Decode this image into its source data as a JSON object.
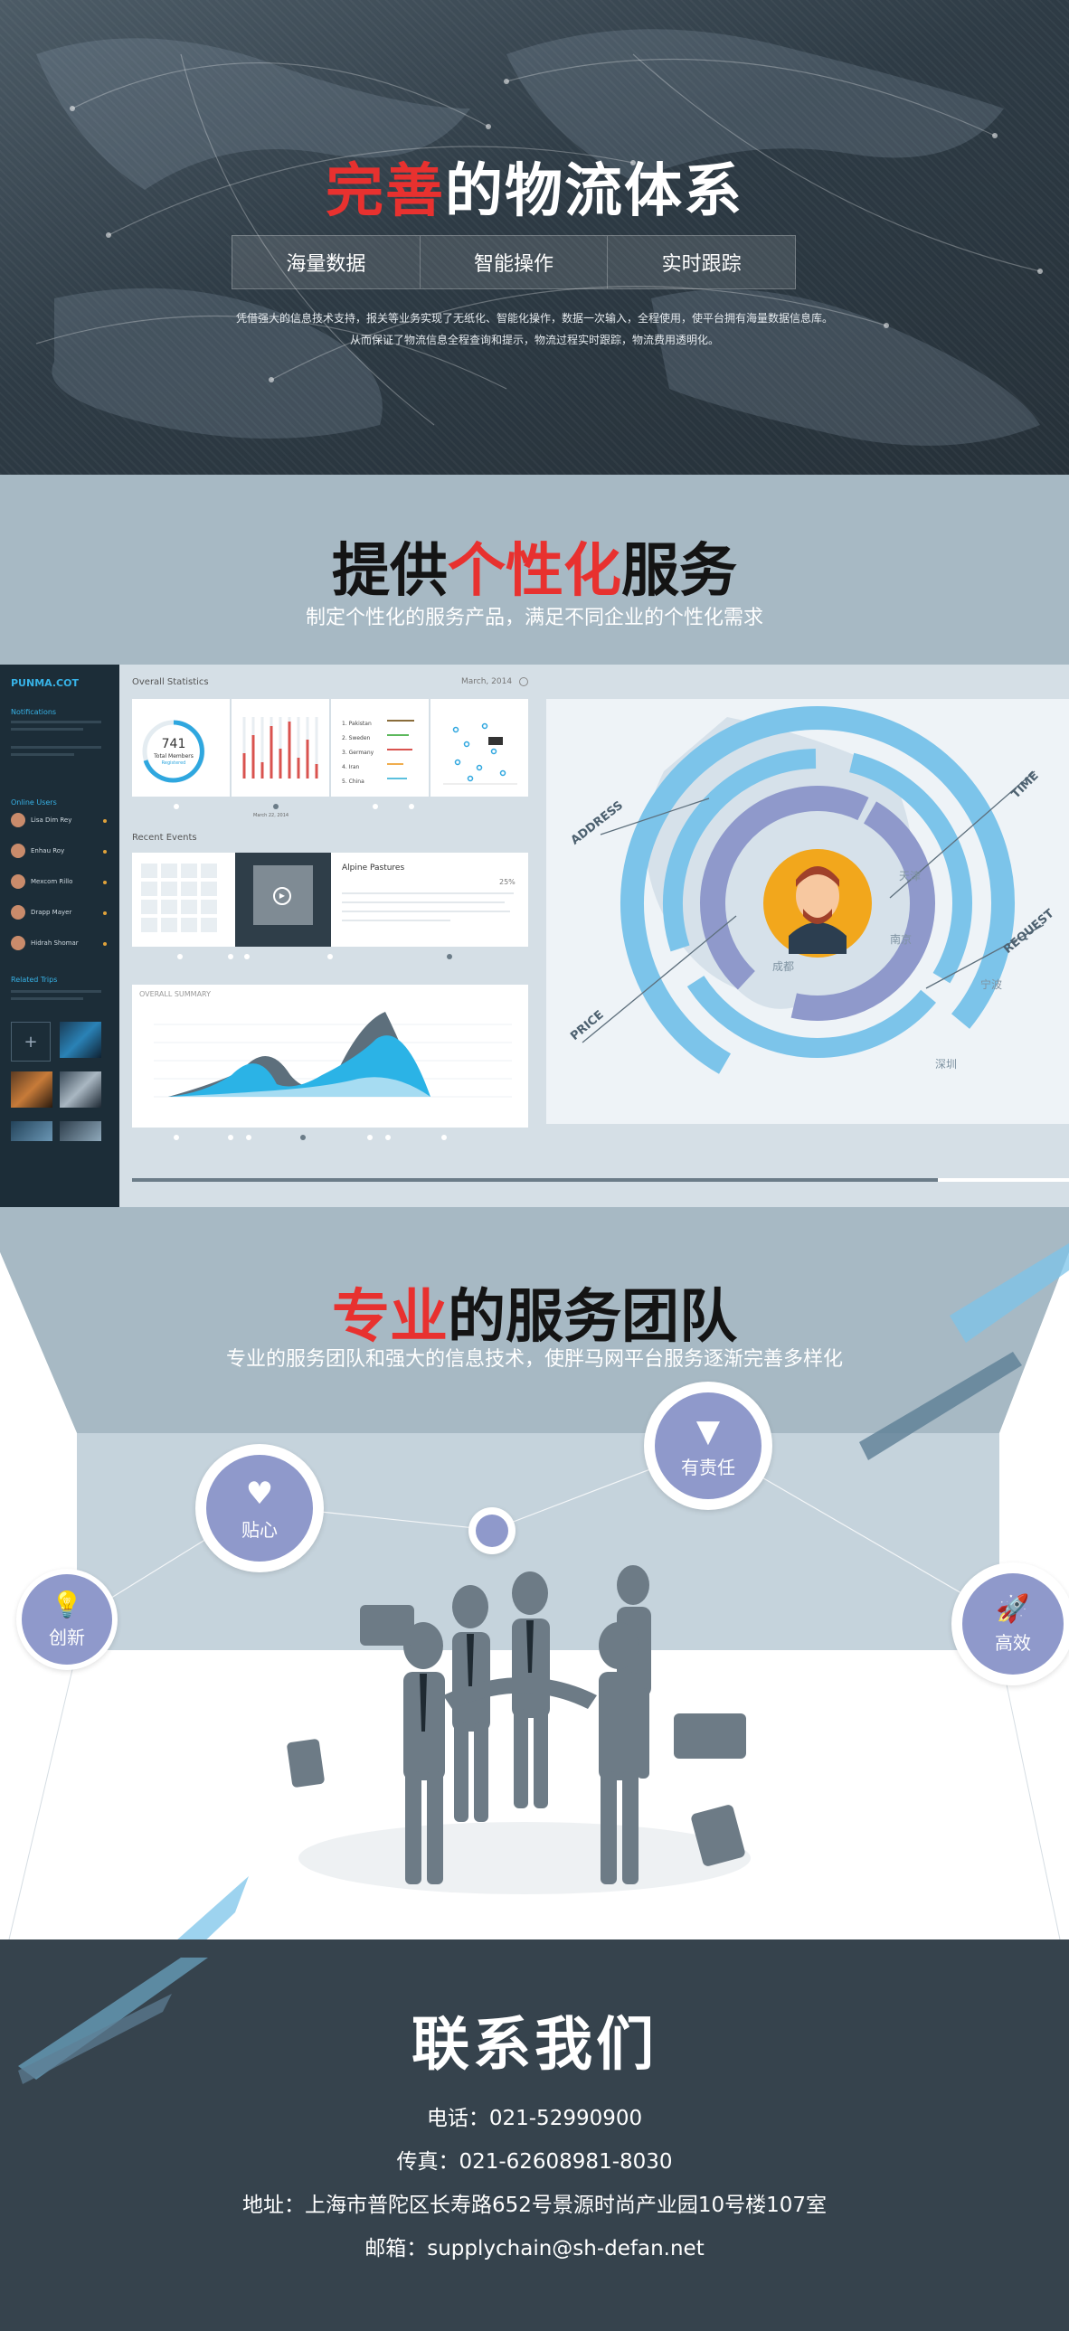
{
  "hero": {
    "title_red": "完善",
    "title_rest": "的物流体系",
    "tabs": [
      "海量数据",
      "智能操作",
      "实时跟踪"
    ],
    "desc_line1": "凭借强大的信息技术支持，报关等业务实现了无纸化、智能化操作，数据一次输入，全程使用，使平台拥有海量数据信息库。",
    "desc_line2": "从而保证了物流信息全程查询和提示，物流过程实时跟踪，物流费用透明化。"
  },
  "service": {
    "title_before": "提供",
    "title_red": "个性化",
    "title_after": "服务",
    "subtitle": "制定个性化的服务产品，满足不同企业的个性化需求"
  },
  "dashboard": {
    "brand": "PUNMA.COT",
    "notifications": "Notifications",
    "online_users": "Online Users",
    "users": [
      "Lisa Dim Rey",
      "Enhau Roy",
      "Mexcom Rillo",
      "Drapp Mayer",
      "Hidrah Shomar"
    ],
    "related": "Related Trips",
    "overview_title": "Overall Statistics",
    "overview_date": "March, 2014",
    "members_value": "741",
    "members_label": "Total Members",
    "members_sub": "Registered",
    "countries": [
      "1.  Pakistan",
      "2.  Sweden",
      "3.  Germany",
      "4.  Iran",
      "5.  China"
    ],
    "recent_events": "Recent Events",
    "event_title": "Alpine Pastures",
    "event_percent": "25%",
    "summary_title": "OVERALL SUMMARY",
    "date_label": "March 22, 2014",
    "infographic_labels": [
      "ADDRESS",
      "TIME",
      "PRICE",
      "REQUEST"
    ],
    "map_cities": [
      "天津",
      "南京",
      "成都",
      "宁波",
      "深圳"
    ]
  },
  "team": {
    "title_red": "专业",
    "title_rest": "的服务团队",
    "subtitle": "专业的服务团队和强大的信息技术，使胖马网平台服务逐渐完善多样化",
    "badges": {
      "create": "创新",
      "care": "贴心",
      "responsible": "有责任",
      "efficient": "高效"
    }
  },
  "contact": {
    "title": "联系我们",
    "phone": "电话：021-52990900",
    "fax": "传真：021-62608981-8030",
    "address": "地址：上海市普陀区长寿路652号景源时尚产业园10号楼107室",
    "email": "邮箱：supplychain@sh-defan.net"
  },
  "colors": {
    "accent_red": "#e8312f",
    "badge_purple": "#8f99cb",
    "section_blue": "#a7b9c4",
    "footer_dark": "#36434d"
  }
}
